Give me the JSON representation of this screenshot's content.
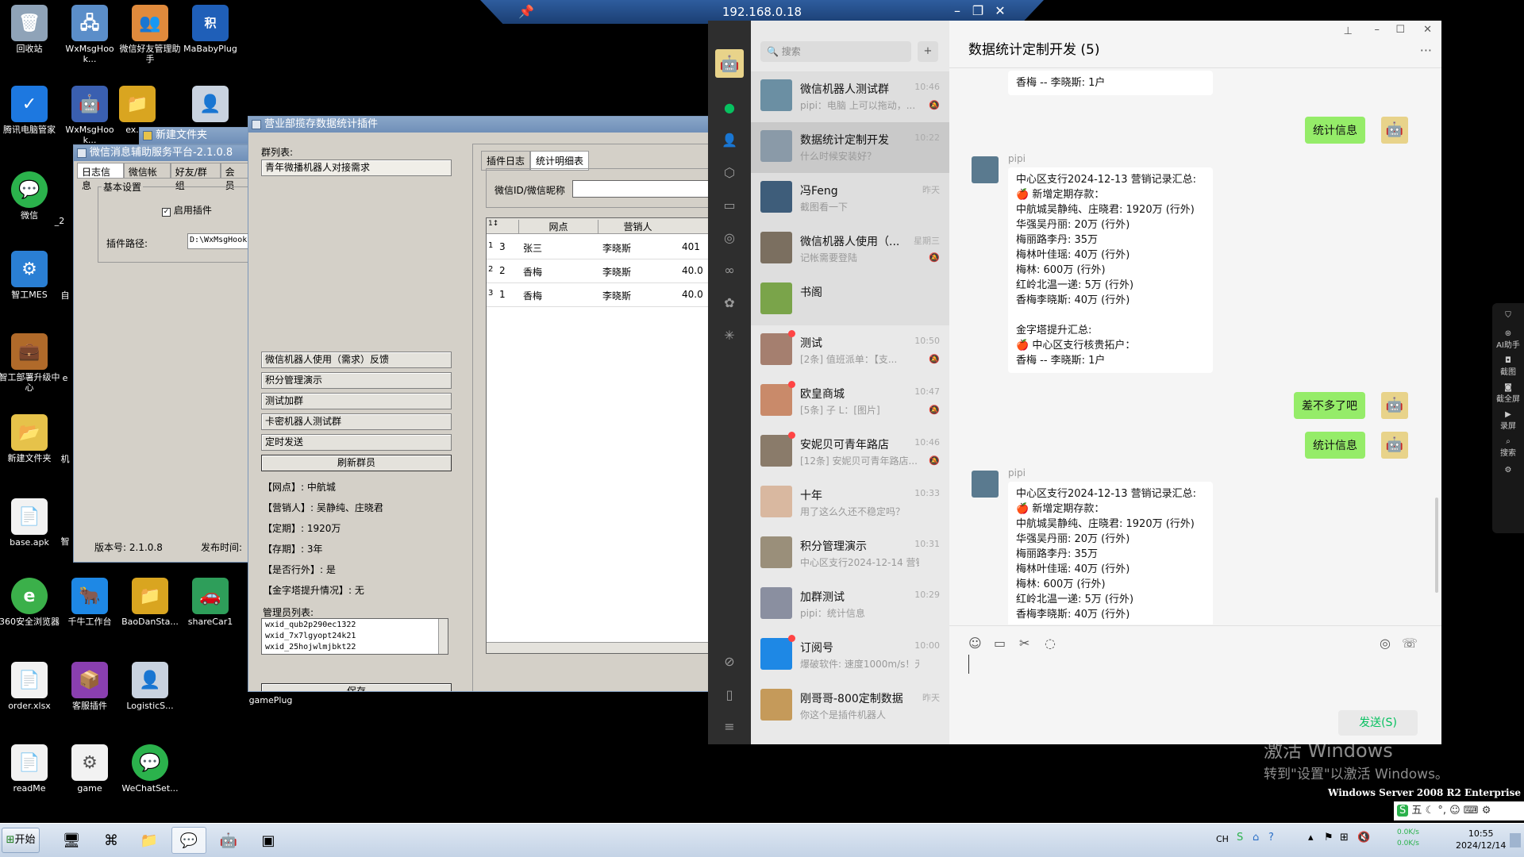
{
  "desktop_icons": [
    {
      "label": "回收站",
      "icon": "recycle-bin-icon"
    },
    {
      "label": "WxMsgHook...",
      "icon": "network-icon"
    },
    {
      "label": "微信好友管理助手",
      "icon": "users-icon"
    },
    {
      "label": "MaBabyPlug",
      "icon": "points-icon"
    },
    {
      "label": "腾讯电脑管家",
      "icon": "shield-icon"
    },
    {
      "label": "WxMsgHook...",
      "icon": "robot-icon"
    },
    {
      "label": "ex...",
      "icon": "folder-app-icon"
    },
    {
      "label": "",
      "icon": "person-icon"
    },
    {
      "label": "微信",
      "icon": "wechat-icon"
    },
    {
      "label": "智工MES",
      "icon": "gear-icon"
    },
    {
      "label": "智工部署升级中心",
      "icon": "briefcase-icon"
    },
    {
      "label": "新建文件夹",
      "icon": "folder-icon"
    },
    {
      "label": "base.apk",
      "icon": "file-icon"
    },
    {
      "label": "360安全浏览器",
      "icon": "browser-icon"
    },
    {
      "label": "千牛工作台",
      "icon": "qianniu-icon"
    },
    {
      "label": "BaoDanSta...",
      "icon": "folder-app-icon"
    },
    {
      "label": "shareCar1",
      "icon": "car-icon"
    },
    {
      "label": "order.xlsx",
      "icon": "file-icon"
    },
    {
      "label": "客服插件",
      "icon": "archive-icon"
    },
    {
      "label": "LogisticS...",
      "icon": "person-icon"
    },
    {
      "label": "gamePlug",
      "icon": "file-icon"
    },
    {
      "label": "readMe",
      "icon": "file-icon"
    },
    {
      "label": "game",
      "icon": "settings-file-icon"
    },
    {
      "label": "WeChatSet...",
      "icon": "wechat-icon"
    },
    {
      "label": "自",
      "icon": ""
    },
    {
      "label": "机",
      "icon": ""
    },
    {
      "label": "智",
      "icon": ""
    },
    {
      "label": "e",
      "icon": ""
    },
    {
      "label": "_2",
      "icon": ""
    }
  ],
  "rdp_bar": {
    "title": "192.168.0.18"
  },
  "folder_window": {
    "title": "新建文件夹"
  },
  "helper_window": {
    "title": "微信消息辅助服务平台-2.1.0.8",
    "tabs": [
      "日志信息",
      "微信帐号",
      "好友/群组",
      "会员"
    ],
    "group_label": "基本设置",
    "enable_plugin": "启用插件",
    "plugin_path_label": "插件路径:",
    "plugin_path_value": "D:\\WxMsgHookServe",
    "version": "版本号: 2.1.0.8",
    "publish": "发布时间:"
  },
  "plugin_window": {
    "title": "营业部揽存数据统计插件",
    "group_list_label": "群列表:",
    "groups": [
      "青年微播机器人对接需求",
      "微信机器人使用（需求）反馈",
      "积分管理演示",
      "测试加群",
      "卡密机器人测试群",
      "定时发送"
    ],
    "refresh_button": "刷新群员",
    "info_lines": [
      "【网点】: 中航城",
      "【营销人】: 吴静纯、庄晓君",
      "【定期】: 1920万",
      "【存期】: 3年",
      "【是否行外】: 是",
      "【金字塔提升情况】: 无"
    ],
    "admin_label": "管理员列表:",
    "admins": [
      "wxid_qub2p290ec1322",
      "wxid_7x7lgyopt24k21",
      "wxid_25hojwlmjbkt22"
    ],
    "save_button": "保存",
    "tabs": [
      "插件日志",
      "统计明细表"
    ],
    "id_label": "微信ID/微信昵称",
    "table": {
      "headers": [
        "网点",
        "营销人"
      ],
      "rows": [
        {
          "idx": "1",
          "no": "3",
          "branch": "张三",
          "person": "李晓斯",
          "extra": "401"
        },
        {
          "idx": "2",
          "no": "2",
          "branch": "香梅",
          "person": "李晓斯",
          "extra": "40.0"
        },
        {
          "idx": "3",
          "no": "1",
          "branch": "香梅",
          "person": "李晓斯",
          "extra": "40.0"
        }
      ]
    }
  },
  "wechat": {
    "search_placeholder": "搜索",
    "chat_title": "数据统计定制开发 (5)",
    "chats": [
      {
        "name": "微信机器人测试群",
        "time": "10:46",
        "preview": "pipi：电脑 上可以拖动，...",
        "muted": true,
        "dot": false
      },
      {
        "name": "数据统计定制开发",
        "time": "10:22",
        "preview": "什么时候安装好？",
        "muted": false,
        "dot": false
      },
      {
        "name": "冯Feng",
        "time": "昨天",
        "preview": "截图看一下",
        "muted": false,
        "dot": false
      },
      {
        "name": "微信机器人使用（...",
        "time": "星期三",
        "preview": "记帐需要登陆",
        "muted": true,
        "dot": false
      },
      {
        "name": "书阁",
        "time": "",
        "preview": "",
        "muted": false,
        "dot": false
      },
      {
        "name": "测试",
        "time": "10:50",
        "preview": "[2条] 值班派单：【支...",
        "muted": true,
        "dot": true
      },
      {
        "name": "欧皇商城",
        "time": "10:47",
        "preview": "[5条] 子 L：[图片]",
        "muted": true,
        "dot": true
      },
      {
        "name": "安妮贝可青年路店",
        "time": "10:46",
        "preview": "[12条] 安妮贝可青年路店...",
        "muted": true,
        "dot": true
      },
      {
        "name": "十年",
        "time": "10:33",
        "preview": "用了这么久还不稳定吗？",
        "muted": false,
        "dot": false
      },
      {
        "name": "积分管理演示",
        "time": "10:31",
        "preview": "中心区支行2024-12-14 营销...",
        "muted": false,
        "dot": false
      },
      {
        "name": "加群测试",
        "time": "10:29",
        "preview": "pipi：统计信息",
        "muted": false,
        "dot": false
      },
      {
        "name": "订阅号",
        "time": "10:00",
        "preview": "爆破软件: 速度1000m/s！无...",
        "muted": false,
        "dot": true
      },
      {
        "name": "刚哥哥-800定制数据...",
        "time": "昨天",
        "preview": "你这个是插件机器人",
        "muted": false,
        "dot": false
      }
    ],
    "messages": {
      "top_partial": "香梅 -- 李晓斯: 1户",
      "stat_btn_1": "统计信息",
      "sender": "pipi",
      "report_1": "中心区支行2024-12-13 营销记录汇总:\n🍎 新增定期存款：\n中航城吴静纯、庄晓君: 1920万 (行外)\n华强吴丹丽: 20万 (行外)\n梅丽路李丹: 35万\n梅林叶佳瑶: 40万 (行外)\n梅林: 600万 (行外)\n红岭北温一递: 5万 (行外)\n香梅李晓斯: 40万 (行外)\n\n金字塔提升汇总:\n🍎 中心区支行核贵拓户：\n香梅 -- 李晓斯: 1户",
      "reply_1": "差不多了吧",
      "stat_btn_2": "统计信息",
      "sender_2": "pipi",
      "report_2": "中心区支行2024-12-13 营销记录汇总:\n🍎 新增定期存款：\n中航城吴静纯、庄晓君: 1920万 (行外)\n华强吴丹丽: 20万 (行外)\n梅丽路李丹: 35万\n梅林叶佳瑶: 40万 (行外)\n梅林: 600万 (行外)\n红岭北温一递: 5万 (行外)\n香梅李晓斯: 40万 (行外)"
    },
    "send_button": "发送(S)"
  },
  "side_tools": [
    "AI助手",
    "截图",
    "截全屏",
    "录屏",
    "搜索"
  ],
  "watermark": {
    "line1": "激活 Windows",
    "line2": "转到\"设置\"以激活 Windows。",
    "edition": "Windows Server 2008 R2 Enterprise"
  },
  "taskbar": {
    "start": "开始",
    "lang": "CH",
    "time": "10:55",
    "date": "2024/12/14",
    "ime": "五",
    "net_up": "0.0K/s",
    "net_down": "0.0K/s"
  },
  "colors": {
    "wechat_green": "#07c160",
    "bubble_green": "#95ec69",
    "nav_dark": "#2e2e2e"
  }
}
